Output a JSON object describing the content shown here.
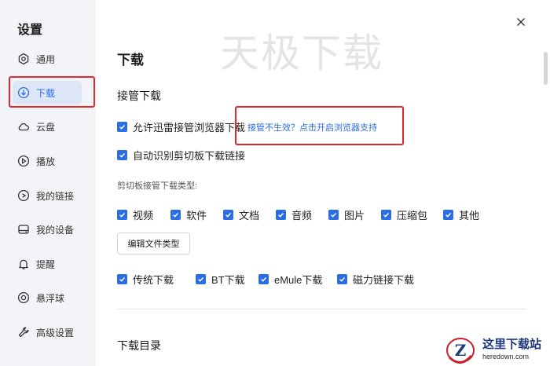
{
  "sidebar": {
    "title": "设置",
    "items": [
      {
        "label": "通用",
        "icon": "hexagon-settings-icon"
      },
      {
        "label": "下载",
        "icon": "download-circle-icon",
        "active": true
      },
      {
        "label": "云盘",
        "icon": "cloud-icon"
      },
      {
        "label": "播放",
        "icon": "play-circle-icon"
      },
      {
        "label": "我的链接",
        "icon": "link-circle-icon"
      },
      {
        "label": "我的设备",
        "icon": "device-icon"
      },
      {
        "label": "提醒",
        "icon": "bell-icon"
      },
      {
        "label": "悬浮球",
        "icon": "float-ball-icon"
      },
      {
        "label": "高级设置",
        "icon": "wrench-icon"
      }
    ]
  },
  "watermark": "天极下载",
  "main": {
    "title": "下载",
    "takeover": {
      "heading": "接管下载",
      "allow_browser": "允许迅雷接管浏览器下载",
      "allow_browser_checked": true,
      "fix_link": "接管不生效？点击开启浏览器支持",
      "clipboard_detect": "自动识别剪切板下载链接",
      "clipboard_detect_checked": true,
      "clipboard_types_label": "剪切板接管下载类型:",
      "file_types": [
        {
          "label": "视频",
          "checked": true
        },
        {
          "label": "软件",
          "checked": true
        },
        {
          "label": "文档",
          "checked": true
        },
        {
          "label": "音频",
          "checked": true
        },
        {
          "label": "图片",
          "checked": true
        },
        {
          "label": "压缩包",
          "checked": true
        },
        {
          "label": "其他",
          "checked": true
        }
      ],
      "edit_types_button": "编辑文件类型",
      "protocols": [
        {
          "label": "传统下载",
          "checked": true
        },
        {
          "label": "BT下载",
          "checked": true
        },
        {
          "label": "eMule下载",
          "checked": true
        },
        {
          "label": "磁力链接下载",
          "checked": true
        }
      ]
    },
    "directory_heading": "下载目录"
  },
  "site_logo": {
    "letter": "Z",
    "name": "这里下载站",
    "domain": "heredown.com"
  },
  "colors": {
    "accent": "#2b6de5",
    "highlight": "#e5262b",
    "sidebar_bg": "#f3f4f7"
  }
}
